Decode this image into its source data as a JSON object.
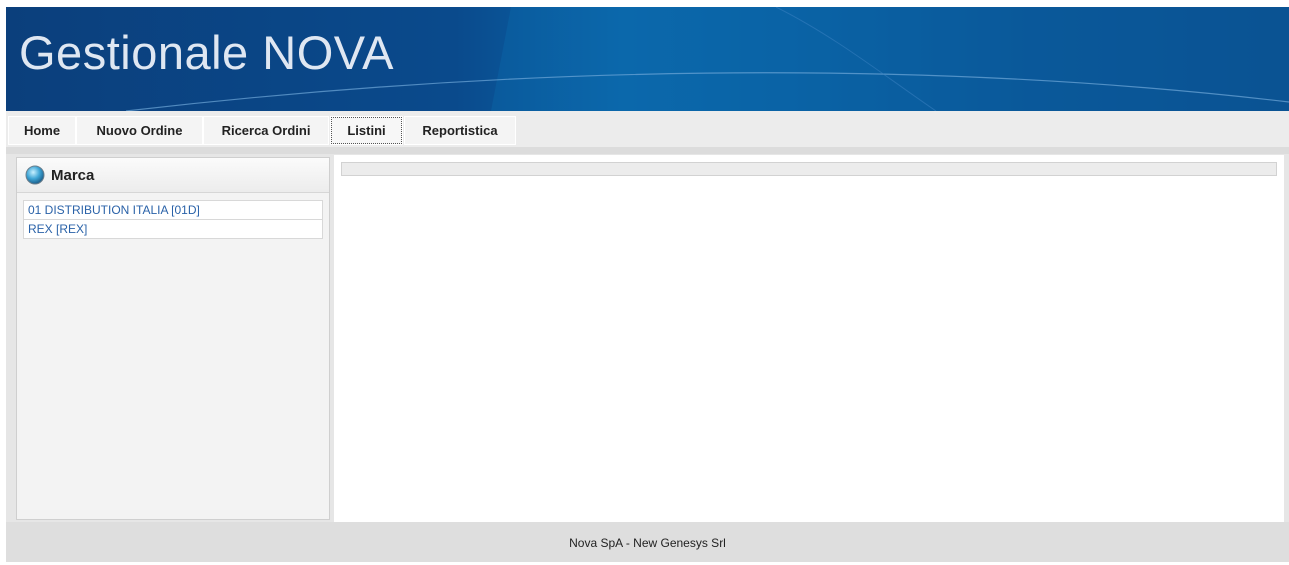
{
  "app": {
    "title": "Gestionale NOVA"
  },
  "nav": {
    "tabs": [
      {
        "label": "Home"
      },
      {
        "label": "Nuovo Ordine"
      },
      {
        "label": "Ricerca Ordini"
      },
      {
        "label": "Listini",
        "active": true
      },
      {
        "label": "Reportistica"
      }
    ]
  },
  "sidebar": {
    "title": "Marca",
    "icon": "globe-icon",
    "items": [
      {
        "label": "01 DISTRIBUTION ITALIA [01D]"
      },
      {
        "label": "REX [REX]"
      }
    ]
  },
  "footer": {
    "text": "Nova SpA - New Genesys Srl"
  },
  "colors": {
    "banner": "#0a4a8c",
    "link": "#2a62a8"
  }
}
